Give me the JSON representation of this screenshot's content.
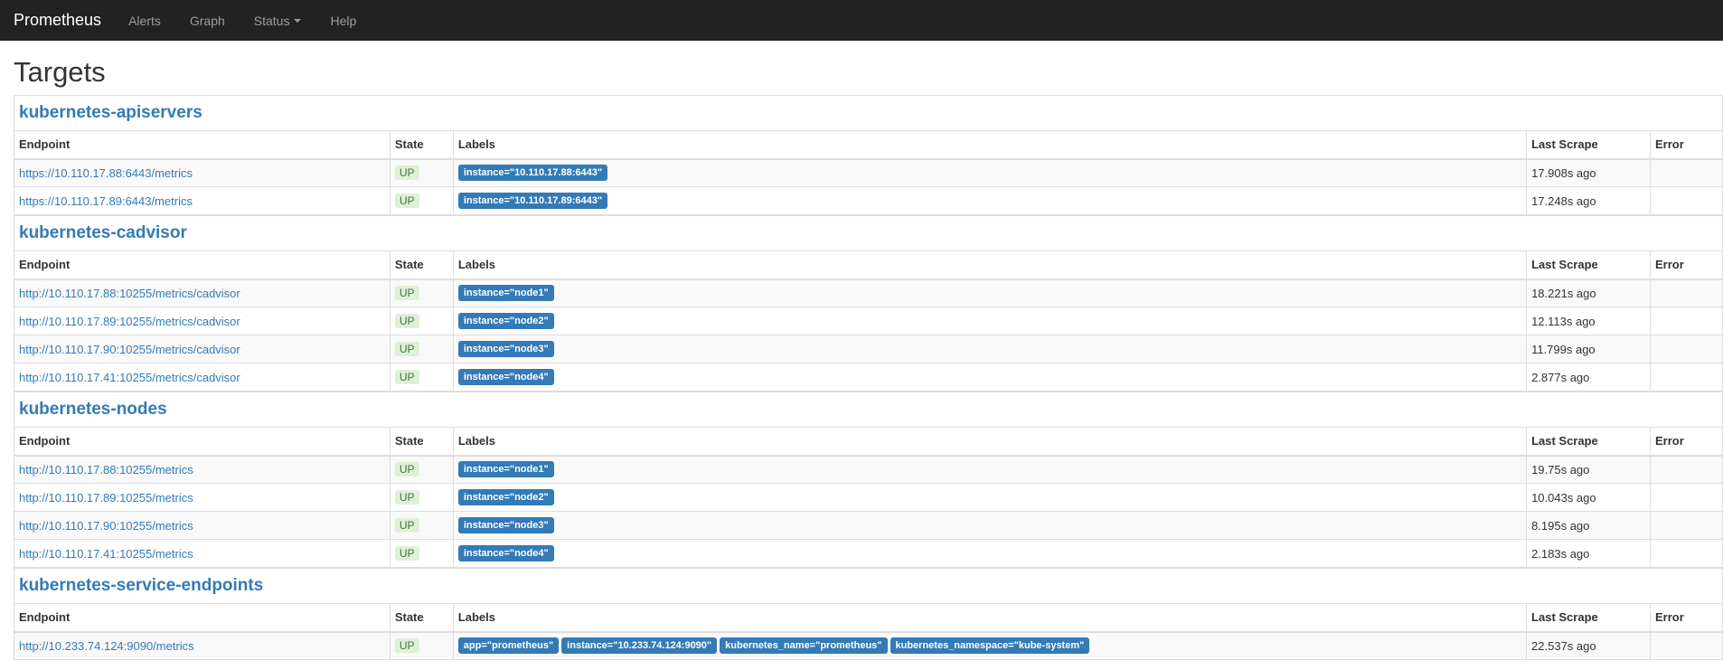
{
  "navbar": {
    "brand": "Prometheus",
    "links": [
      "Alerts",
      "Graph",
      "Status",
      "Help"
    ]
  },
  "page_title": "Targets",
  "columns": {
    "endpoint": "Endpoint",
    "state": "State",
    "labels": "Labels",
    "last_scrape": "Last Scrape",
    "error": "Error"
  },
  "jobs": [
    {
      "name": "kubernetes-apiservers",
      "targets": [
        {
          "endpoint": "https://10.110.17.88:6443/metrics",
          "state": "UP",
          "labels": [
            "instance=\"10.110.17.88:6443\""
          ],
          "last_scrape": "17.908s ago",
          "error": ""
        },
        {
          "endpoint": "https://10.110.17.89:6443/metrics",
          "state": "UP",
          "labels": [
            "instance=\"10.110.17.89:6443\""
          ],
          "last_scrape": "17.248s ago",
          "error": ""
        }
      ]
    },
    {
      "name": "kubernetes-cadvisor",
      "targets": [
        {
          "endpoint": "http://10.110.17.88:10255/metrics/cadvisor",
          "state": "UP",
          "labels": [
            "instance=\"node1\""
          ],
          "last_scrape": "18.221s ago",
          "error": ""
        },
        {
          "endpoint": "http://10.110.17.89:10255/metrics/cadvisor",
          "state": "UP",
          "labels": [
            "instance=\"node2\""
          ],
          "last_scrape": "12.113s ago",
          "error": ""
        },
        {
          "endpoint": "http://10.110.17.90:10255/metrics/cadvisor",
          "state": "UP",
          "labels": [
            "instance=\"node3\""
          ],
          "last_scrape": "11.799s ago",
          "error": ""
        },
        {
          "endpoint": "http://10.110.17.41:10255/metrics/cadvisor",
          "state": "UP",
          "labels": [
            "instance=\"node4\""
          ],
          "last_scrape": "2.877s ago",
          "error": ""
        }
      ]
    },
    {
      "name": "kubernetes-nodes",
      "targets": [
        {
          "endpoint": "http://10.110.17.88:10255/metrics",
          "state": "UP",
          "labels": [
            "instance=\"node1\""
          ],
          "last_scrape": "19.75s ago",
          "error": ""
        },
        {
          "endpoint": "http://10.110.17.89:10255/metrics",
          "state": "UP",
          "labels": [
            "instance=\"node2\""
          ],
          "last_scrape": "10.043s ago",
          "error": ""
        },
        {
          "endpoint": "http://10.110.17.90:10255/metrics",
          "state": "UP",
          "labels": [
            "instance=\"node3\""
          ],
          "last_scrape": "8.195s ago",
          "error": ""
        },
        {
          "endpoint": "http://10.110.17.41:10255/metrics",
          "state": "UP",
          "labels": [
            "instance=\"node4\""
          ],
          "last_scrape": "2.183s ago",
          "error": ""
        }
      ]
    },
    {
      "name": "kubernetes-service-endpoints",
      "targets": [
        {
          "endpoint": "http://10.233.74.124:9090/metrics",
          "state": "UP",
          "labels": [
            "app=\"prometheus\"",
            "instance=\"10.233.74.124:9090\"",
            "kubernetes_name=\"prometheus\"",
            "kubernetes_namespace=\"kube-system\""
          ],
          "last_scrape": "22.537s ago",
          "error": ""
        }
      ]
    }
  ]
}
